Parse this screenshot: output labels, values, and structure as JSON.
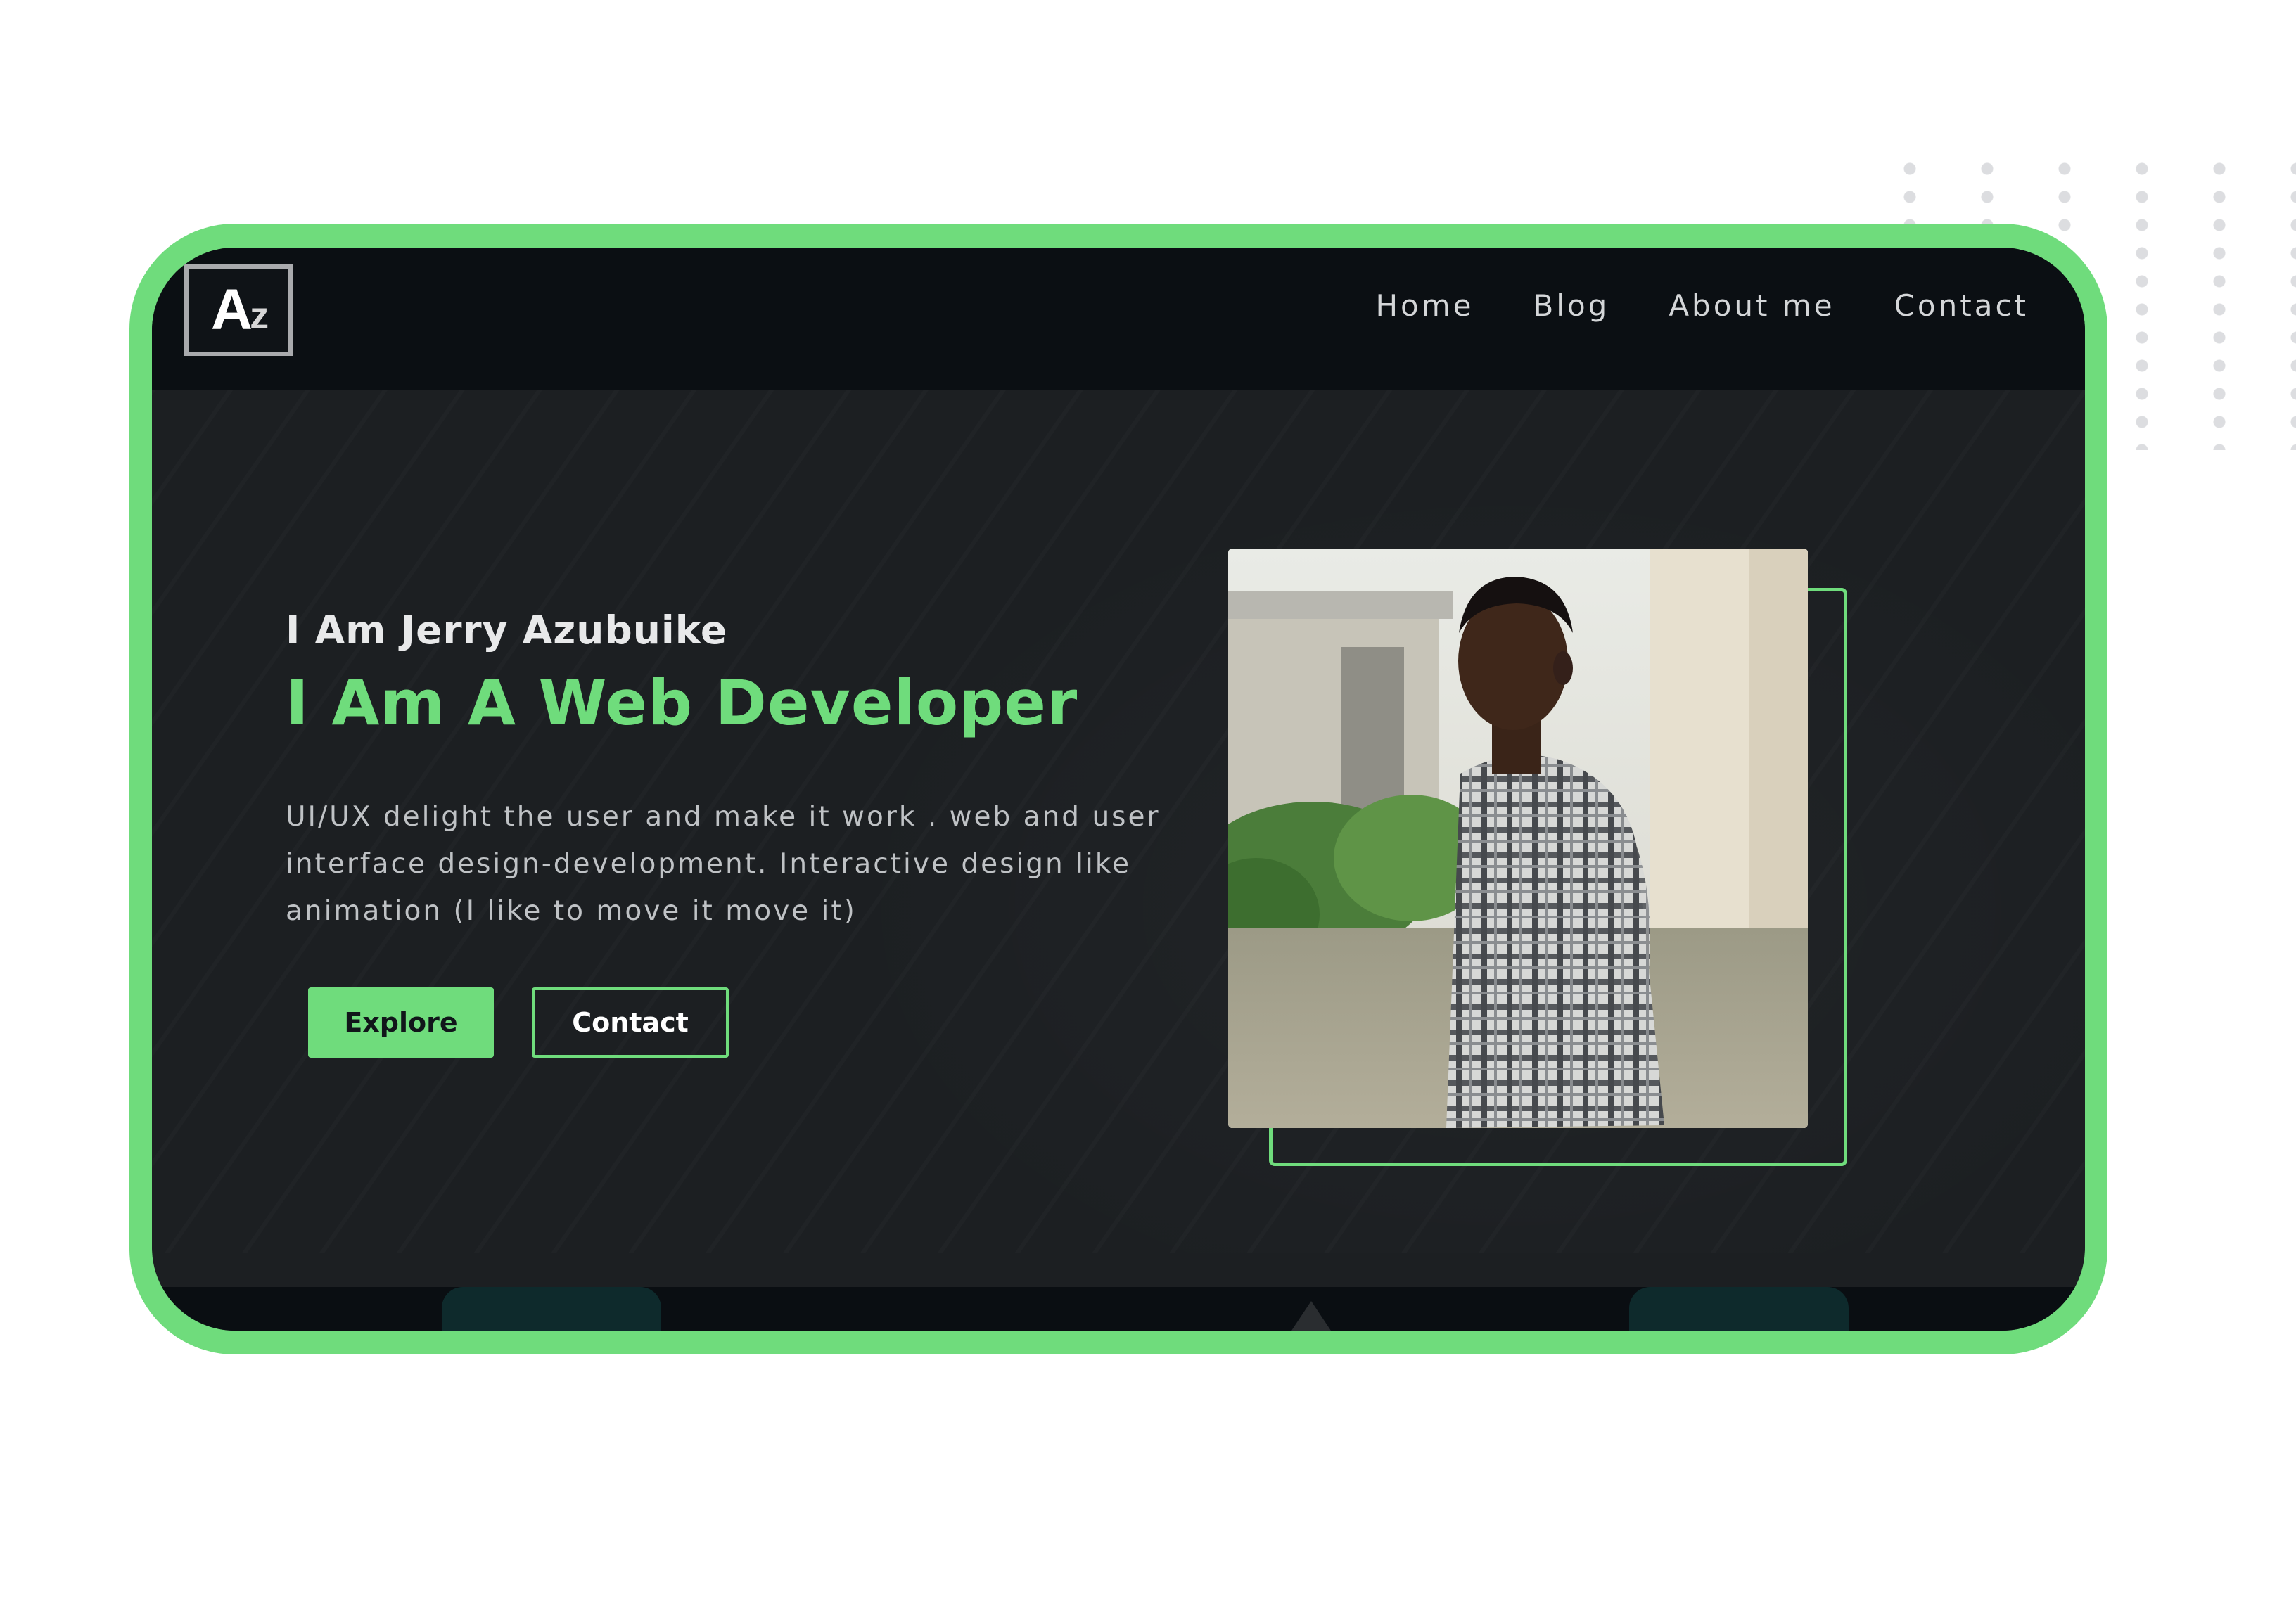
{
  "brand": {
    "logo_big": "A",
    "logo_small": "z"
  },
  "nav": {
    "items": [
      {
        "label": "Home"
      },
      {
        "label": "Blog"
      },
      {
        "label": "About me"
      },
      {
        "label": "Contact"
      }
    ]
  },
  "hero": {
    "intro": "I Am Jerry Azubuike",
    "title": "I Am A Web Developer",
    "description": "UI/UX delight the user and make it work . web and user interface design-development. Interactive design like animation (I like to move it move it)",
    "explore_label": "Explore",
    "contact_label": "Contact"
  },
  "colors": {
    "accent": "#6fdc7c",
    "background": "#1c1f22",
    "navbar": "#0b0f13"
  }
}
